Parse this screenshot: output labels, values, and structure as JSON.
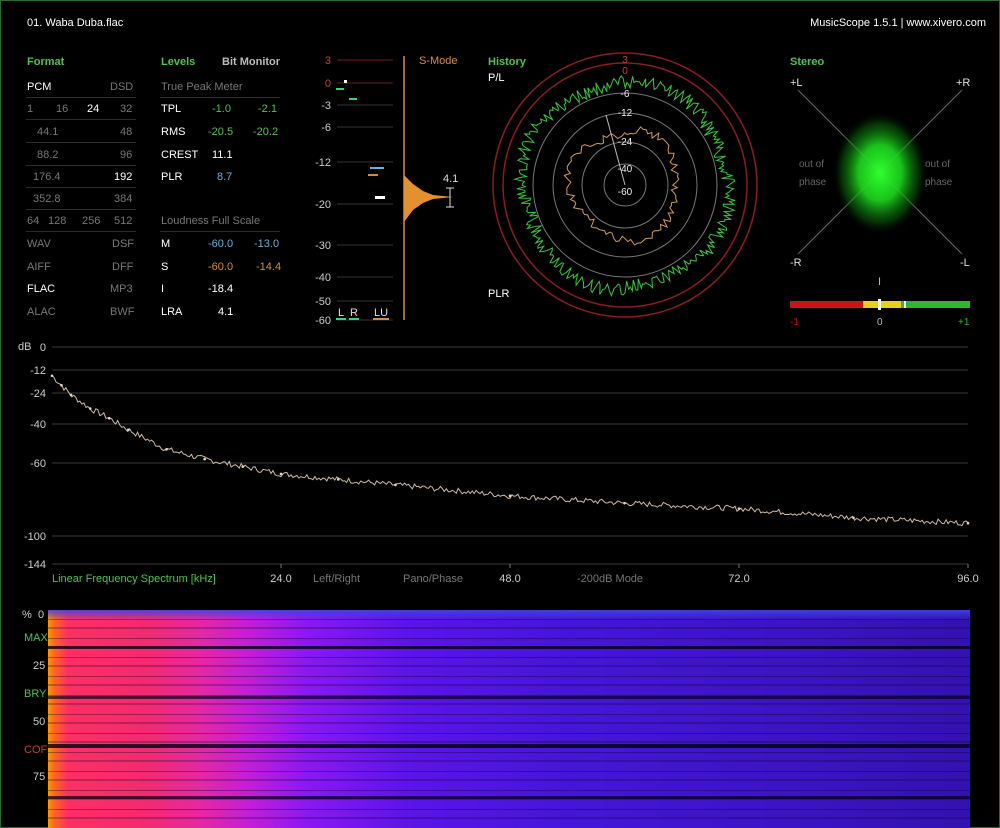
{
  "header": {
    "track": "01. Waba Duba.flac",
    "app": "MusicScope 1.5.1 | www.xivero.com"
  },
  "format": {
    "title": "Format",
    "pcm": "PCM",
    "dsd": "DSD",
    "bits": [
      "1",
      "16",
      "24",
      "32"
    ],
    "rates": [
      {
        "left": "44.1",
        "right": "48"
      },
      {
        "left": "88.2",
        "right": "96"
      },
      {
        "left": "176.4",
        "right": "192"
      },
      {
        "left": "352.8",
        "right": "384"
      }
    ],
    "dsd_rates": [
      "64",
      "128",
      "256",
      "512"
    ],
    "types": [
      {
        "left": "WAV",
        "right": "DSF"
      },
      {
        "left": "AIFF",
        "right": "DFF"
      },
      {
        "left": "FLAC",
        "right": "MP3"
      },
      {
        "left": "ALAC",
        "right": "BWF"
      }
    ]
  },
  "levels": {
    "title": "Levels",
    "bit_monitor": "Bit Monitor",
    "tpm_title": "True Peak Meter",
    "rows": [
      {
        "label": "TPL",
        "l": "-1.0",
        "r": "-2.1"
      },
      {
        "label": "RMS",
        "l": "-20.5",
        "r": "-20.2"
      },
      {
        "label": "CREST",
        "l": "11.1"
      },
      {
        "label": "PLR",
        "l": "8.7"
      }
    ],
    "lfs_title": "Loudness Full Scale",
    "lfs_rows": [
      {
        "label": "M",
        "l": "-60.0",
        "r": "-13.0"
      },
      {
        "label": "S",
        "l": "-60.0",
        "r": "-14.4"
      },
      {
        "label": "I",
        "l": "-18.4"
      },
      {
        "label": "LRA",
        "l": "4.1"
      }
    ]
  },
  "meter": {
    "scale": [
      "3",
      "0",
      "-3",
      "-6",
      "-12",
      "-20",
      "-30",
      "-40",
      "-50",
      "-60"
    ],
    "mode": "S-Mode",
    "value": "4.1",
    "channels": [
      "L",
      "R",
      "LU"
    ]
  },
  "history": {
    "title": "History",
    "pl": "P/L",
    "plr": "PLR",
    "rings": [
      "3",
      "0",
      "-6",
      "-12",
      "-24",
      "-40",
      "-60"
    ]
  },
  "stereo": {
    "title": "Stereo",
    "plus_l": "+L",
    "plus_r": "+R",
    "minus_r": "-R",
    "minus_l": "-L",
    "out_of": "out of",
    "phase": "phase",
    "corr_ticks": [
      "-1",
      "0",
      "+1"
    ],
    "corr_marker": "I"
  },
  "spectrum": {
    "db_label": "dB",
    "db_ticks": [
      "0",
      "-12",
      "-24",
      "-40",
      "-60",
      "-100",
      "-144"
    ],
    "title": "Linear Frequency Spectrum [kHz]",
    "modes": [
      "Left/Right",
      "Pano/Phase",
      "-200dB Mode"
    ],
    "freq_ticks": [
      "24.0",
      "48.0",
      "72.0",
      "96.0"
    ],
    "chart_data": {
      "type": "line",
      "x": [
        0,
        1,
        2,
        4,
        6,
        8,
        12,
        16,
        20,
        24,
        30,
        36,
        48,
        60,
        72,
        84,
        96
      ],
      "y": [
        -15,
        -20,
        -25,
        -32,
        -37,
        -43,
        -53,
        -58,
        -62,
        -66,
        -69,
        -72,
        -78,
        -82,
        -85,
        -90,
        -93
      ],
      "xlabel": "Linear Frequency Spectrum [kHz]",
      "ylabel": "dB",
      "xlim": [
        0,
        96
      ],
      "ylim": [
        -144,
        0
      ]
    }
  },
  "spectrogram": {
    "pct": "%",
    "ticks": [
      "0",
      "25",
      "50",
      "75"
    ],
    "tags": [
      {
        "label": "MAX",
        "color": "#4ec34e"
      },
      {
        "label": "BRY",
        "color": "#4ec34e"
      },
      {
        "label": "COF",
        "color": "#d13a2a"
      }
    ]
  }
}
